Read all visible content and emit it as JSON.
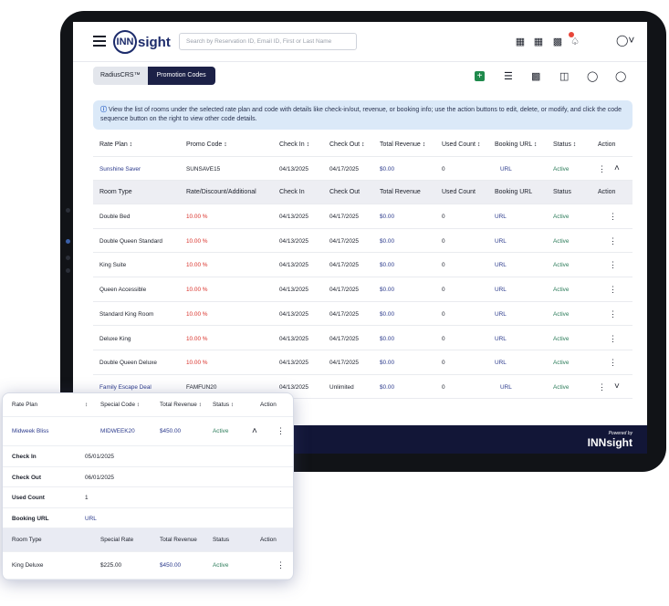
{
  "app": {
    "search_placeholder": "Search by Reservation ID, Email ID, First or Last Name",
    "logo_text_a": "INN",
    "logo_text_b": "sight",
    "icons": [
      "calendar-icon",
      "grid-icon",
      "dashboard-icon",
      "bell-icon",
      "user-icon"
    ]
  },
  "breadcrumb": {
    "item1": "RadiusCRS™",
    "item2": "Promotion Codes"
  },
  "info_text": "View the list of rooms under the selected rate plan and code with details like check-in/out, revenue, or booking info; use the action buttons to edit, delete, or modify, and click the code sequence button on the right to view other code details.",
  "table": {
    "headers": [
      "Rate Plan",
      "Promo Code",
      "Check In",
      "Check Out",
      "Total Revenue",
      "Used Count",
      "Booking URL",
      "Status",
      "Action"
    ],
    "rows": [
      {
        "rate_plan": "Sunshine Saver",
        "promo_code": "SUNSAVE15",
        "check_in": "04/13/2025",
        "check_out": "04/17/2025",
        "revenue": "$0.00",
        "used": "0",
        "url": "URL",
        "status": "Active"
      },
      {
        "rate_plan": "Family Escape Deal",
        "promo_code": "FAMFUN20",
        "check_in": "04/13/2025",
        "check_out": "Unlimited",
        "revenue": "$0.00",
        "used": "0",
        "url": "URL",
        "status": "Active"
      }
    ],
    "sub_headers": [
      "Room Type",
      "Rate/Discount/Additional",
      "Check In",
      "Check Out",
      "Total Revenue",
      "Used Count",
      "Booking URL",
      "Status",
      "Action"
    ],
    "sub_rows": [
      {
        "room": "Double Bed",
        "rate": "10.00 %",
        "check_in": "04/13/2025",
        "check_out": "04/17/2025",
        "revenue": "$0.00",
        "used": "0",
        "url": "URL",
        "status": "Active"
      },
      {
        "room": "Double Queen Standard",
        "rate": "10.00 %",
        "check_in": "04/13/2025",
        "check_out": "04/17/2025",
        "revenue": "$0.00",
        "used": "0",
        "url": "URL",
        "status": "Active"
      },
      {
        "room": "King Suite",
        "rate": "10.00 %",
        "check_in": "04/13/2025",
        "check_out": "04/17/2025",
        "revenue": "$0.00",
        "used": "0",
        "url": "URL",
        "status": "Active"
      },
      {
        "room": "Queen Accessible",
        "rate": "10.00 %",
        "check_in": "04/13/2025",
        "check_out": "04/17/2025",
        "revenue": "$0.00",
        "used": "0",
        "url": "URL",
        "status": "Active"
      },
      {
        "room": "Standard King Room",
        "rate": "10.00 %",
        "check_in": "04/13/2025",
        "check_out": "04/17/2025",
        "revenue": "$0.00",
        "used": "0",
        "url": "URL",
        "status": "Active"
      },
      {
        "room": "Deluxe King",
        "rate": "10.00 %",
        "check_in": "04/13/2025",
        "check_out": "04/17/2025",
        "revenue": "$0.00",
        "used": "0",
        "url": "URL",
        "status": "Active"
      },
      {
        "room": "Double Queen Deluxe",
        "rate": "10.00 %",
        "check_in": "04/13/2025",
        "check_out": "04/17/2025",
        "revenue": "$0.00",
        "used": "0",
        "url": "URL",
        "status": "Active"
      }
    ]
  },
  "footer": {
    "powered_by": "Powered by",
    "brand": "INNsight"
  },
  "card": {
    "headers": [
      "Rate Plan",
      "Special Code",
      "Total Revenue",
      "Status",
      "Action"
    ],
    "row": {
      "rate_plan": "Midweek Bliss",
      "code": "MIDWEEK20",
      "revenue": "$450.00",
      "status": "Active"
    },
    "details": [
      {
        "label": "Check In",
        "value": "05/01/2025"
      },
      {
        "label": "Check Out",
        "value": "06/01/2025"
      },
      {
        "label": "Used Count",
        "value": "1"
      },
      {
        "label": "Booking URL",
        "value": "URL"
      }
    ],
    "sub_headers": [
      "Room Type",
      "Special Rate",
      "Total Revenue",
      "Status",
      "Action"
    ],
    "sub_row": {
      "room": "King Deluxe",
      "rate": "$225.00",
      "revenue": "$450.00",
      "status": "Active"
    }
  }
}
